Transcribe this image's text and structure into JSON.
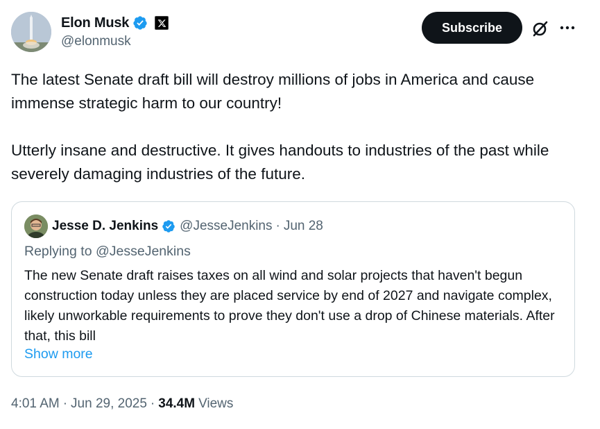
{
  "author": {
    "name": "Elon Musk",
    "handle": "@elonmusk",
    "avatar_icon": "rocket-launch-avatar",
    "verified_color": "#1d9bf0",
    "affiliate_badge_icon": "x-logo-icon"
  },
  "actions": {
    "subscribe_label": "Subscribe",
    "grok_icon": "grok-icon",
    "more_icon": "more-dots-icon"
  },
  "tweet": {
    "paragraphs": [
      "The latest Senate draft bill will destroy millions of jobs in America and cause immense strategic harm to our country!",
      "Utterly insane and destructive. It gives handouts to industries of the past while severely damaging industries of the future."
    ]
  },
  "quoted": {
    "name": "Jesse D. Jenkins",
    "handle": "@JesseJenkins",
    "separator": "·",
    "date": "Jun 28",
    "replying_to": "Replying to @JesseJenkins",
    "text": "The new Senate draft raises taxes on all wind and solar projects that haven't begun construction today unless they are placed service by end of 2027 and navigate complex, likely unworkable requirements to prove they don't use a drop of Chinese materials. After that, this bill",
    "show_more": "Show more"
  },
  "footer": {
    "time": "4:01 AM",
    "date": "Jun 29, 2025",
    "views_count": "34.4M",
    "views_label": "Views"
  },
  "colors": {
    "text_primary": "#0f1419",
    "text_secondary": "#536471",
    "link": "#1d9bf0",
    "border": "#cfd9de",
    "button_bg": "#0f1419"
  }
}
